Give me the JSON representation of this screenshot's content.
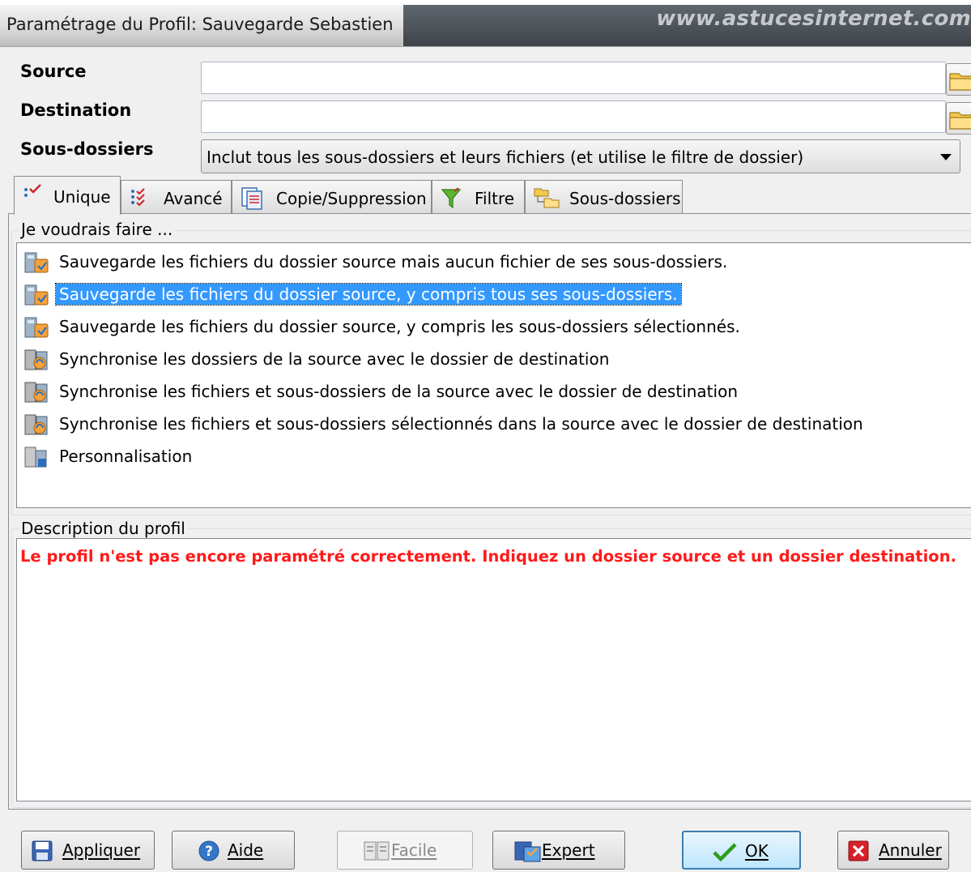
{
  "window": {
    "title": "Paramétrage du Profil: Sauvegarde Sebastien",
    "watermark": "www.astucesinternet.com"
  },
  "source": {
    "label": "Source",
    "value": ""
  },
  "destination": {
    "label": "Destination",
    "value": ""
  },
  "subfolders": {
    "label": "Sous-dossiers",
    "selected": "Inclut tous les sous-dossiers et leurs fichiers (et utilise le filtre de dossier)"
  },
  "tabs": [
    {
      "label": "Unique",
      "icon": "checklist-icon",
      "active": true
    },
    {
      "label": "Avancé",
      "icon": "advanced-list-icon",
      "active": false
    },
    {
      "label": "Copie/Suppression",
      "icon": "copy-delete-icon",
      "active": false
    },
    {
      "label": "Filtre",
      "icon": "funnel-icon",
      "active": false
    },
    {
      "label": "Sous-dossiers",
      "icon": "folder-tree-icon",
      "active": false
    }
  ],
  "options_group": {
    "title": "Je voudrais faire ...",
    "items": [
      {
        "label": "Sauvegarde les fichiers du dossier source mais aucun fichier de ses sous-dossiers.",
        "icon": "backup-icon",
        "selected": false
      },
      {
        "label": "Sauvegarde les fichiers du dossier source, y compris tous ses sous-dossiers.",
        "icon": "backup-icon",
        "selected": true
      },
      {
        "label": "Sauvegarde les fichiers du dossier source, y compris les sous-dossiers sélectionnés.",
        "icon": "backup-icon",
        "selected": false
      },
      {
        "label": "Synchronise les dossiers de la source avec le dossier de destination",
        "icon": "sync-icon",
        "selected": false
      },
      {
        "label": "Synchronise les fichiers et sous-dossiers de la source avec le dossier de destination",
        "icon": "sync-icon",
        "selected": false
      },
      {
        "label": "Synchronise les fichiers et sous-dossiers sélectionnés dans la source avec le dossier de destination",
        "icon": "sync-icon",
        "selected": false
      },
      {
        "label": "Personnalisation",
        "icon": "custom-icon",
        "selected": false
      }
    ]
  },
  "description_group": {
    "title": "Description du profil",
    "text": "Le profil n'est pas encore paramétré correctement. Indiquez un dossier source et un dossier destination.",
    "text_color": "#ff1a1a"
  },
  "buttons": {
    "apply": "Appliquer",
    "help": "Aide",
    "easy": "Facile",
    "expert": "Expert",
    "ok": "OK",
    "cancel": "Annuler"
  },
  "colors": {
    "selection": "#3399ff",
    "default_button_border": "#3c7fb1"
  }
}
